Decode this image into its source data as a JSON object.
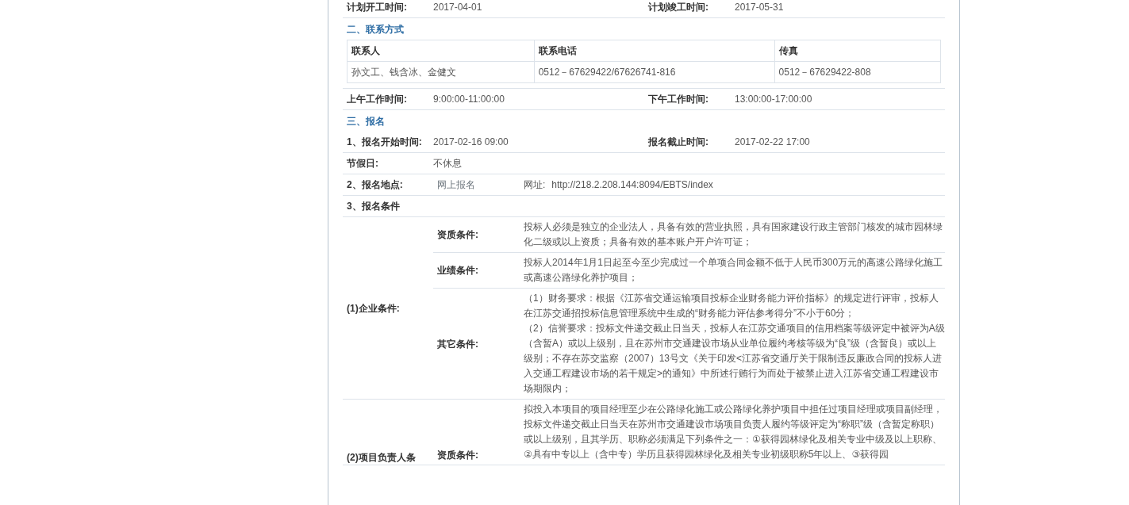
{
  "top_row": [
    {
      "label": "计划开工时间:",
      "value": "2017-04-01"
    },
    {
      "label": "计划竣工时间:",
      "value": "2017-05-31"
    }
  ],
  "contact": {
    "heading": "二、联系方式",
    "columns": [
      "联系人",
      "联系电话",
      "传真"
    ],
    "rows": [
      [
        "孙文工、钱含冰、金健文",
        "0512－67629422/67626741-816",
        "0512－67629422-808"
      ]
    ]
  },
  "work_hours": [
    {
      "label": "上午工作时间:",
      "value": "9:00:00-11:00:00"
    },
    {
      "label": "下午工作时间:",
      "value": "13:00:00-17:00:00"
    }
  ],
  "registration": {
    "heading": "三、报名",
    "rows": [
      {
        "kind": "pair",
        "items": [
          {
            "label": "1、报名开始时间:",
            "value": "2017-02-16 09:00"
          },
          {
            "label": "报名截止时间:",
            "value": "2017-02-22 17:00"
          }
        ]
      },
      {
        "kind": "single",
        "label": "节假日:",
        "value": "不休息"
      },
      {
        "kind": "site",
        "label": "2、报名地点:",
        "value": "网上报名",
        "url_label": "网址:",
        "url": "http://218.2.208.144:8094/EBTS/index"
      },
      {
        "kind": "title",
        "label": "3、报名条件"
      }
    ],
    "conditions": [
      {
        "label": "(1)企业条件:",
        "items": [
          {
            "label": "资质条件:",
            "lines": [
              "投标人必须是独立的企业法人，具备有效的营业执照，具有国家建设行政主管部门核发的城市园林绿化二级或以上资质；具备有效的基本账户开户许可证；"
            ]
          },
          {
            "label": "业绩条件:",
            "lines": [
              "投标人2014年1月1日起至今至少完成过一个单项合同金额不低于人民币300万元的高速公路绿化施工或高速公路绿化养护项目；"
            ]
          },
          {
            "label": "其它条件:",
            "lines": [
              "（1）财务要求：根据《江苏省交通运输项目投标企业财务能力评价指标》的规定进行评审，投标人在江苏交通招投标信息管理系统中生成的“财务能力评估参考得分”不小于60分；",
              "（2）信誉要求：投标文件递交截止日当天，投标人在江苏交通项目的信用档案等级评定中被评为A级（含暂A）或以上级别，且在苏州市交通建设市场从业单位履约考核等级为“良”级（含暂良）或以上级别；不存在苏交监察（2007）13号文《关于印发<江苏省交通厅关于限制违反廉政合同的投标人进入交通工程建设市场的若干规定>的通知》中所述行贿行为而处于被禁止进入江苏省交通工程建设市场期限内；"
            ]
          }
        ]
      },
      {
        "label": "(2)项目负责人条",
        "items": [
          {
            "label": "资质条件:",
            "lines": [
              "拟投入本项目的项目经理至少在公路绿化施工或公路绿化养护项目中担任过项目经理或项目副经理，投标文件递交截止日当天在苏州市交通建设市场项目负责人履约等级评定为“称职”级（含暂定称职）或以上级别，且其学历、职称必须满足下列条件之一：①获得园林绿化及相关专业中级及以上职称、②具有中专以上（含中专）学历且获得园林绿化及相关专业初级职称5年以上、③获得园"
            ]
          }
        ]
      }
    ]
  }
}
